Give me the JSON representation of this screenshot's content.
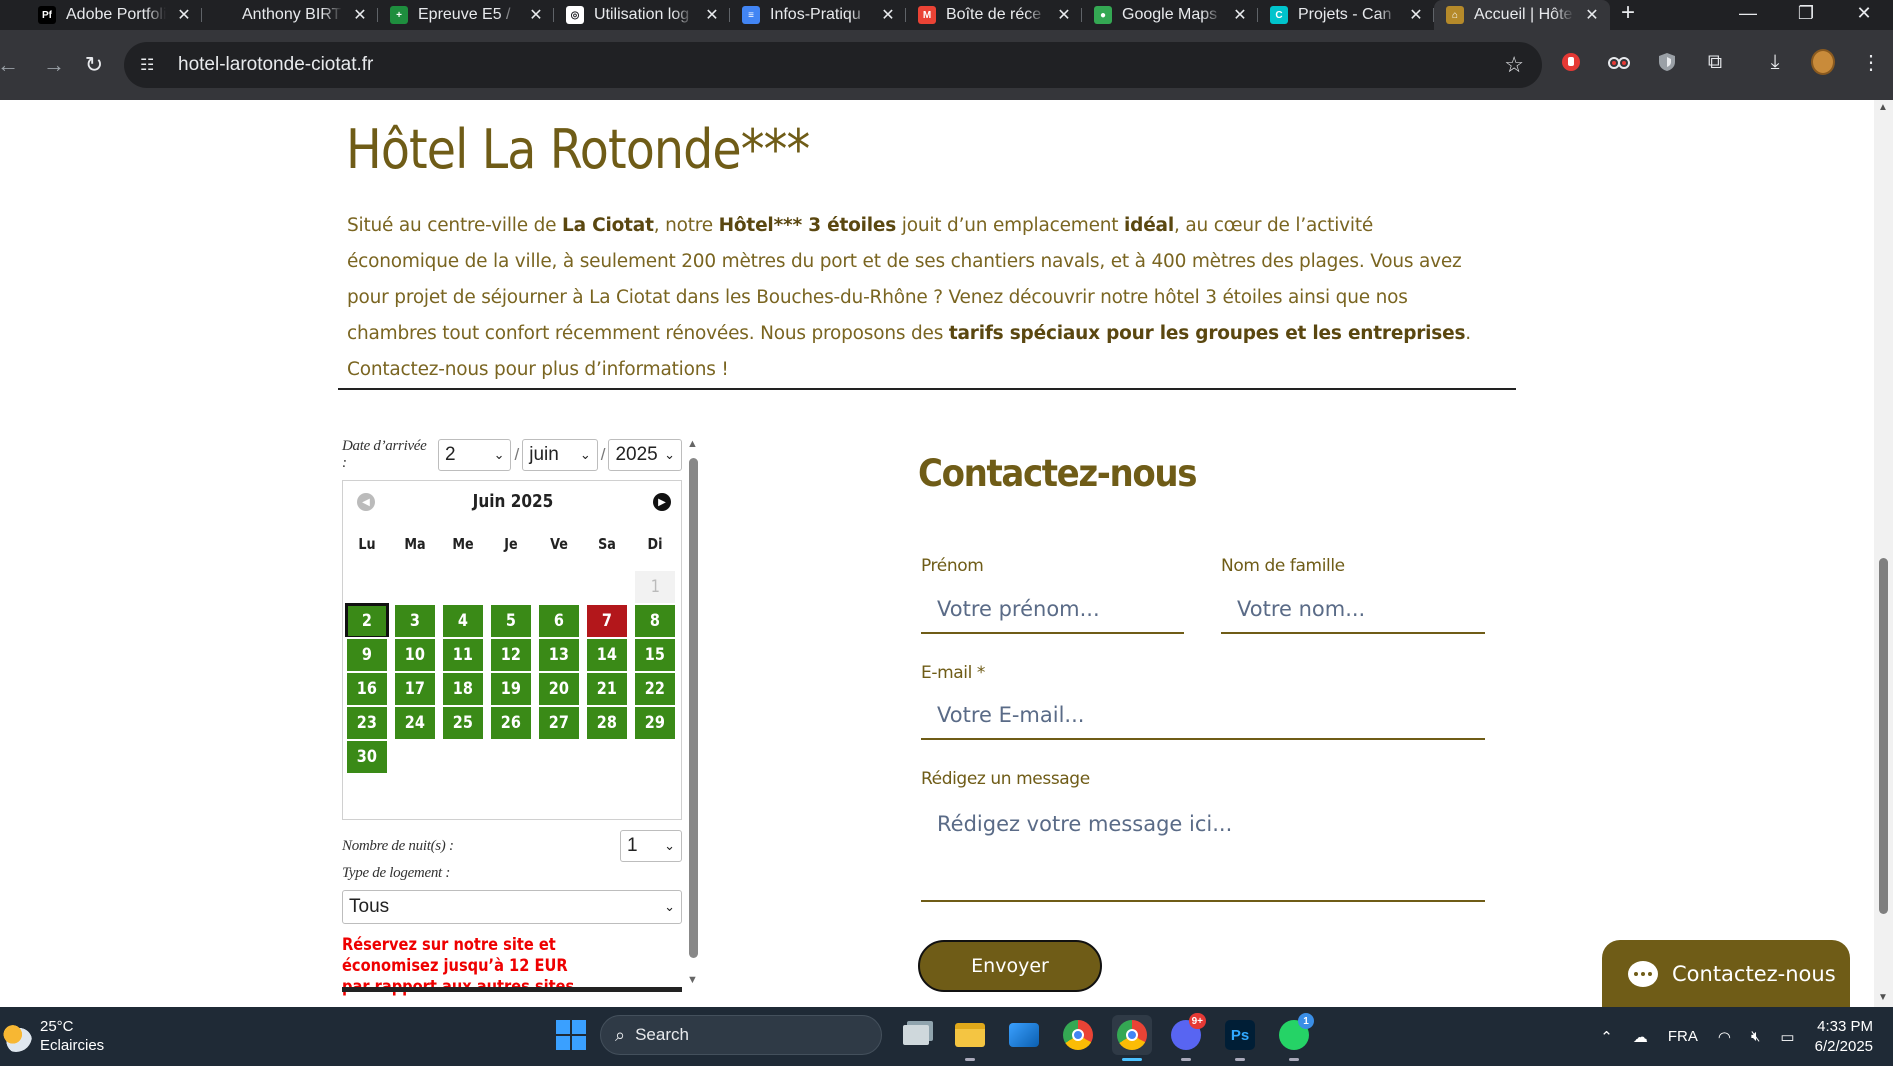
{
  "browser": {
    "tabs": [
      {
        "title": "Adobe Portfolio",
        "favicon": "Pf",
        "color": "#000000"
      },
      {
        "title": "Anthony BIRT",
        "favicon": "",
        "color": "#202124"
      },
      {
        "title": "Epreuve E5 /",
        "favicon": "+",
        "color": "#1e8e3e"
      },
      {
        "title": "Utilisation log",
        "favicon": "◎",
        "color": "#ffffff"
      },
      {
        "title": "Infos-Pratiqu",
        "favicon": "≡",
        "color": "#4285f4"
      },
      {
        "title": "Boîte de réce",
        "favicon": "M",
        "color": "#ea4335"
      },
      {
        "title": "Google Maps",
        "favicon": "●",
        "color": "#34a853"
      },
      {
        "title": "Projets - Can",
        "favicon": "C",
        "color": "#00c4cc"
      },
      {
        "title": "Accueil | Hôte",
        "favicon": "⌂",
        "color": "#b58a2a",
        "active": true
      }
    ],
    "url": "hotel-larotonde-ciotat.fr"
  },
  "page": {
    "title": "Hôtel La Rotonde***",
    "intro": {
      "p1": "Situé au centre-ville de ",
      "b1": "La Ciotat",
      "p2": ", notre ",
      "b2": "Hôtel*** 3 étoiles",
      "p3": " jouit d’un emplacement ",
      "b3": "idéal",
      "p4": ", au cœur de l’activité économique de la ville, à seulement 200 mètres du port et de ses chantiers navals, et à 400 mètres des plages. Vous avez pour projet de séjourner à La Ciotat dans les Bouches-du-Rhône ? Venez découvrir notre hôtel 3 étoiles ainsi que nos chambres tout confort récemment rénovées. Nous proposons des ",
      "b4": "tarifs spéciaux pour les groupes et les entreprises",
      "p5": ". Contactez-nous pour plus d’informations !"
    }
  },
  "booking": {
    "arrival_label": "Date d’arrivée :",
    "day": "2",
    "month": "juin",
    "year": "2025",
    "calendar_title": "Juin 2025",
    "weekdays": [
      "Lu",
      "Ma",
      "Me",
      "Je",
      "Ve",
      "Sa",
      "Di"
    ],
    "first_weekday_index": 6,
    "days_in_month": 30,
    "selected_day": 2,
    "disabled_days": [
      1
    ],
    "full_days": [
      7
    ],
    "nights_label": "Nombre de nuit(s) :",
    "nights": "1",
    "type_label": "Type de logement :",
    "type_value": "Tous",
    "promo": "Réservez sur notre site et économisez jusqu’à 12 EUR par rapport aux autres sites.",
    "available_color": "#3a8a17",
    "full_color": "#b3171b"
  },
  "contact": {
    "heading": "Contactez-nous",
    "firstname_label": "Prénom",
    "firstname_placeholder": "Votre prénom...",
    "lastname_label": "Nom de famille",
    "lastname_placeholder": "Votre nom...",
    "email_label": "E-mail *",
    "email_placeholder": "Votre E-mail...",
    "message_label": "Rédigez un message",
    "message_placeholder": "Rédigez votre message ici...",
    "submit": "Envoyer",
    "chat_label": "Contactez-nous",
    "brand_color": "#6f5c17"
  },
  "taskbar": {
    "temperature": "25°C",
    "weather": "Eclaircies",
    "search": "Search",
    "language": "FRA",
    "time": "4:33 PM",
    "date": "6/2/2025",
    "discord_badge": "9+",
    "whatsapp_badge": "1"
  }
}
